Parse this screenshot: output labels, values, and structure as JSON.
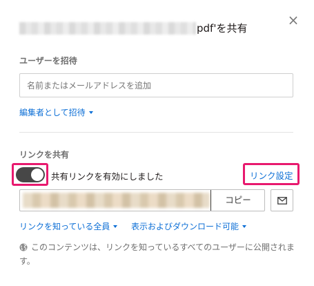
{
  "dialog": {
    "title_suffix": "pdf'を共有",
    "close_glyph": "×"
  },
  "invite": {
    "section_label": "ユーザーを招待",
    "input_placeholder": "名前またはメールアドレスを追加",
    "role_dropdown": "編集者として招待"
  },
  "share_link": {
    "section_label": "リンクを共有",
    "toggle_on": true,
    "toggle_label": "共有リンクを有効にしました",
    "settings_link": "リンク設定",
    "copy_button": "コピー",
    "audience_dropdown": "リンクを知っている全員",
    "permission_dropdown": "表示およびダウンロード可能",
    "description": "このコンテンツは、リンクを知っているすべてのユーザーに公開されます。"
  },
  "icons": {
    "close": "close-icon",
    "email": "email-icon",
    "globe": "globe-icon"
  },
  "colors": {
    "link": "#0d6fd6",
    "highlight": "#e8196e",
    "toggle_on": "#474747"
  }
}
